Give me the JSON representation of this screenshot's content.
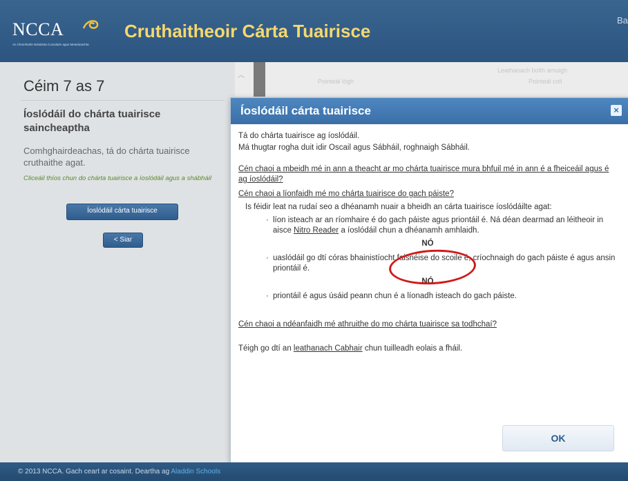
{
  "header": {
    "logo_text": "NCCA",
    "logo_subtitle": "An Chomhairle Náisiúnta Curaclaim agus Measúnachta",
    "app_title": "Cruthaitheoir Cárta Tuairisce",
    "right_text": "Ba"
  },
  "left": {
    "step_title": "Céim 7 as 7",
    "heading": "Íoslódáil do chárta tuairisce saincheaptha",
    "congrats": "Comhghairdeachas, tá do chárta tuairisce cruthaithe agat.",
    "hint": "Cliceáil thíos chun do chárta tuairisce a íoslódáil agus a shábháil",
    "download_button": "Íoslódáil cárta tuairisce",
    "back_button": "< Siar"
  },
  "background": {
    "col1": "Pointeál lógh",
    "col2": "Leathanach bolth amuigh",
    "col3": "Pointeál coll"
  },
  "modal": {
    "title": "Íoslódáil cárta tuairisce",
    "close": "×",
    "line1": "Tá do chárta tuairisce ag íoslódáil.",
    "line2": "Má thugtar rogha duit idir Oscail agus Sábháil, roghnaigh Sábháil.",
    "q1": "Cén chaoi a mbeidh mé in ann a theacht ar mo chárta tuairisce mura bhfuil mé in ann é a fheiceáil agus é ag íoslódáil?",
    "q2": "Cén chaoi a líonfaidh mé mo chárta tuairisce do gach páiste?",
    "intro": "Is féidir leat na rudaí seo a dhéanamh nuair a bheidh an cárta tuairisce íoslódáilte agat:",
    "bullet1_pre": "líon isteach ar an ríomhaire é do gach páiste agus priontáil é. Ná déan dearmad an léitheoir in aisce ",
    "bullet1_link": "Nitro Reader",
    "bullet1_post": " a íoslódáil chun a dhéanamh amhlaidh.",
    "or1": "NÓ",
    "bullet2": "uaslódáil go dtí córas bhainistíocht faisnéise do scoile é, críochnaigh do gach páiste é agus ansin priontáil é.",
    "or2": "NÓ",
    "bullet3": "priontáil é agus úsáid peann chun é a líonadh isteach do gach páiste.",
    "q3": "Cén chaoi a ndéanfaidh mé athruithe do mo chárta tuairisce sa todhchaí?",
    "help_pre": "Téigh go dtí an ",
    "help_link": "leathanach Cabhair",
    "help_post": " chun tuilleadh eolais a fháil.",
    "ok_button": "OK"
  },
  "footer": {
    "text": "© 2013 NCCA. Gach ceart ar cosaint. Deartha ag ",
    "brand": "Aladdin Schools"
  },
  "colors": {
    "header_bg": "#2c5580",
    "title_gold": "#f6d86e",
    "modal_header": "#3b6fa6",
    "annotation_red": "#d01a1a"
  }
}
